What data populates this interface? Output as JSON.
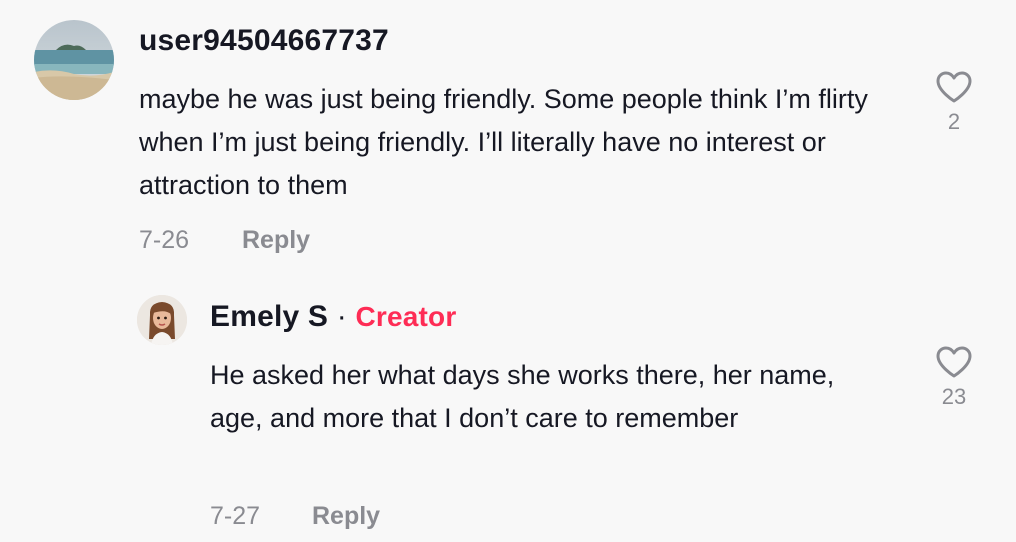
{
  "comments": [
    {
      "username": "user94504667737",
      "text": "maybe he was just being friendly. Some people think I’m flirty when I’m just being friendly. I’ll literally have no interest or attraction to them",
      "date": "7-26",
      "reply_label": "Reply",
      "like_count": "2",
      "avatar_icon": "beach-landscape-avatar"
    },
    {
      "username": "Emely S",
      "separator": "·",
      "badge": "Creator",
      "text": "He asked her what days she works there, her name, age, and more that I don’t care to remember",
      "date": "7-27",
      "reply_label": "Reply",
      "like_count": "23",
      "avatar_icon": "cartoon-woman-avatar"
    }
  ],
  "colors": {
    "creator_badge": "#fe2c55",
    "muted": "#8a8b91",
    "text": "#161823",
    "background": "#f8f8f8"
  }
}
